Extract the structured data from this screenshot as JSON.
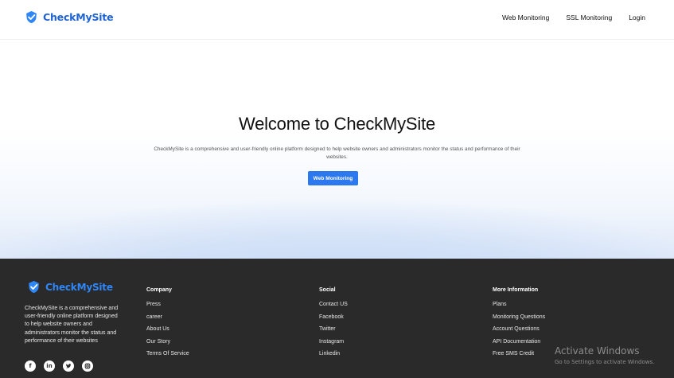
{
  "header": {
    "brand": "CheckMySite",
    "nav": [
      "Web Monitoring",
      "SSL Monitoring",
      "Login"
    ]
  },
  "hero": {
    "title": "Welcome to CheckMySite",
    "description": "CheckMySite is a comprehensive and user-friendly online platform designed to help website owners and administrators monitor the status and performance of their websites.",
    "button": "Web Monitoring"
  },
  "footer": {
    "brand": "CheckMySite",
    "description": "CheckMySite is a comprehensive and user-friendly online platform designed to help website owners and administrators monitor the status and performance of their websites",
    "socials": [
      "facebook-icon",
      "linkedin-icon",
      "twitter-icon",
      "instagram-icon"
    ],
    "company": {
      "heading": "Company",
      "links": [
        "Press",
        "career",
        "About Us",
        "Our Story",
        "Terms Of Service"
      ]
    },
    "social": {
      "heading": "Social",
      "links": [
        "Contact US",
        "Facebook",
        "Twitter",
        "Instagram",
        "Linkedin"
      ]
    },
    "more": {
      "heading": "More Information",
      "links": [
        "Plans",
        "Monitoring Questions",
        "Account Questions",
        "API Documentation",
        "Free SMS Credit"
      ]
    }
  },
  "watermark": {
    "title": "Activate Windows",
    "subtitle": "Go to Settings to activate Windows."
  },
  "colors": {
    "brand": "#1e63d6",
    "button": "#2c78ee",
    "footer_bg": "#2a2a2a"
  }
}
